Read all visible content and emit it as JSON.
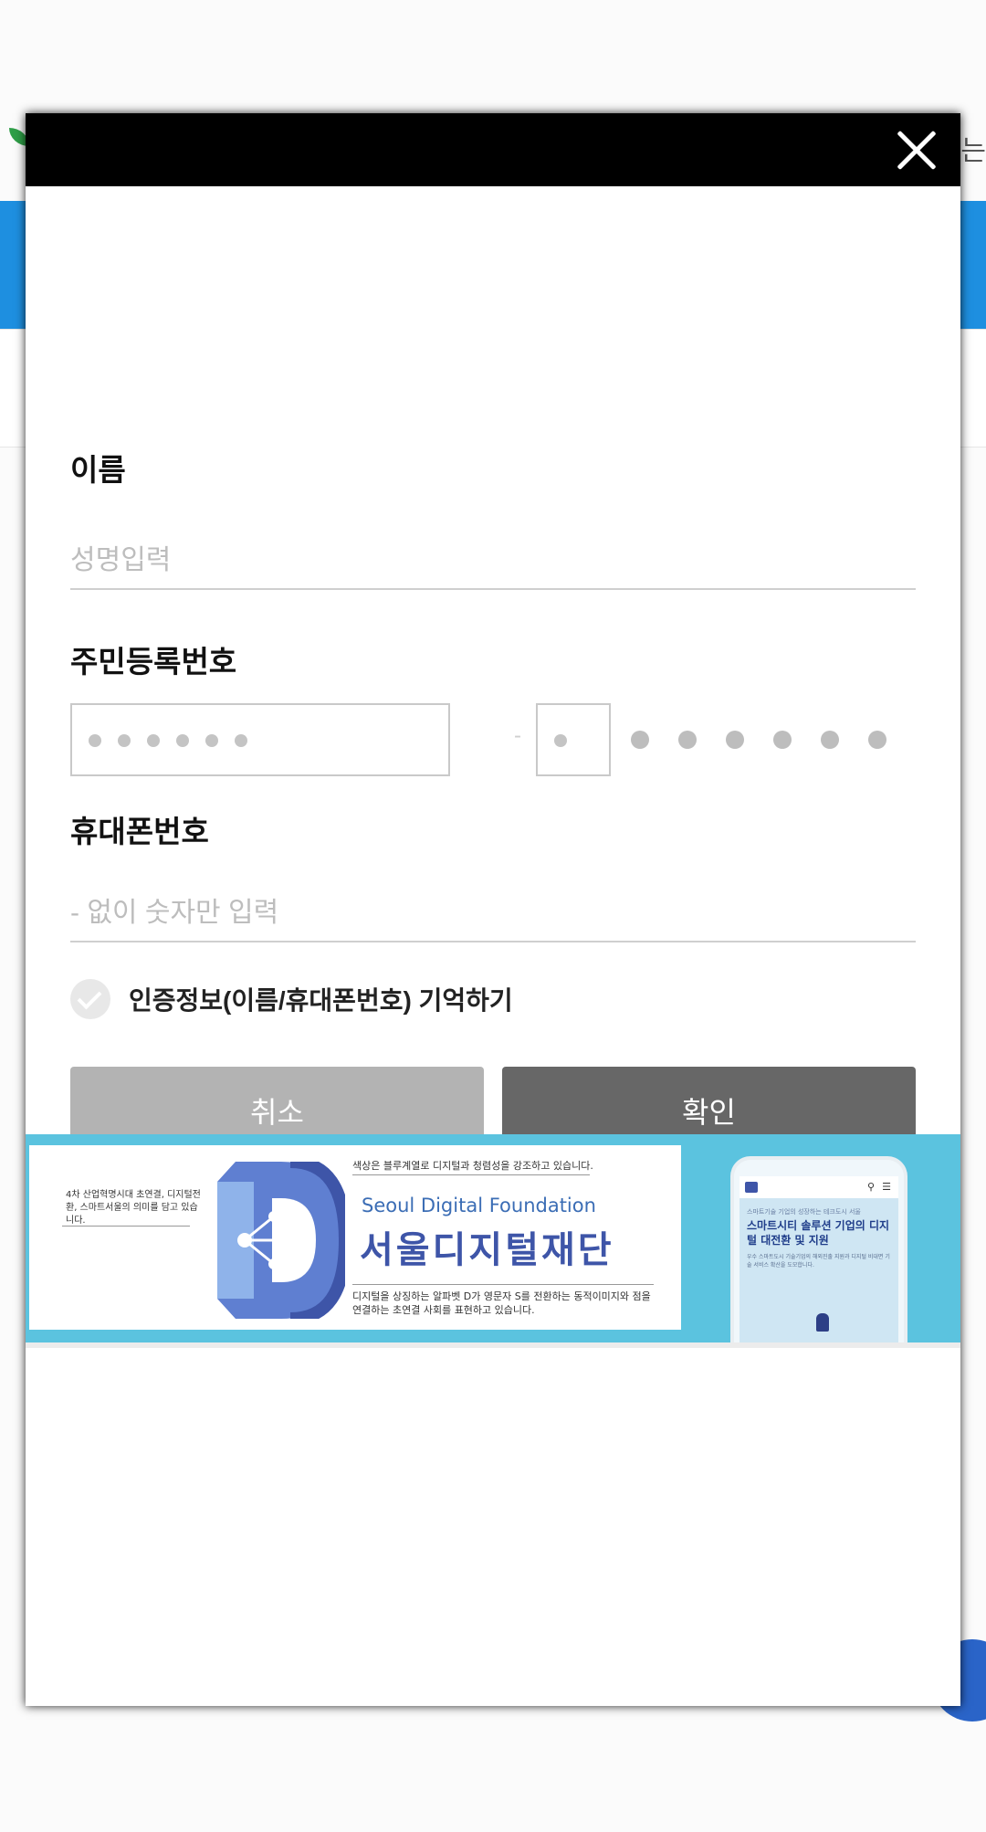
{
  "modal": {
    "close_icon": "close-icon"
  },
  "form": {
    "name_label": "이름",
    "name_placeholder": "성명입력",
    "rrn_label": "주민등록번호",
    "rrn_separator": "-",
    "phone_label": "휴대폰번호",
    "phone_placeholder": "- 없이 숫자만 입력",
    "remember_label": "인증정보(이름/휴대폰번호) 기억하기",
    "remember_checked": false
  },
  "buttons": {
    "cancel": "취소",
    "confirm": "확인"
  },
  "banner": {
    "left_text": "4차 산업혁명시대 초연결, 디지털전환, 스마트서울의 의미를 담고 있습니다.",
    "top_caption": "색상은 블루계열로 디지털과 청렴성을 강조하고 있습니다.",
    "name_en": "Seoul Digital Foundation",
    "name_ko": "서울디지털재단",
    "bottom_caption": "디지털을 상징하는 알파벳 D가 영문자 S를 전환하는 동적이미지와 점을 연결하는 초연결 사회를 표현하고 있습니다.",
    "phone_small": "스마트기술 기업의 성장하는 테크도시 서울",
    "phone_title": "스마트시티 솔루션 기업의 디지털 대전환 및 지원",
    "phone_desc": "우수 스마트도시 기술기업의 해외진출 지원과 디지털 비대면 기술 서비스 확산을 도모합니다.",
    "colors": {
      "accent": "#5bc3df",
      "brand": "#3e55a8"
    }
  },
  "background": {
    "right_char": "는"
  }
}
